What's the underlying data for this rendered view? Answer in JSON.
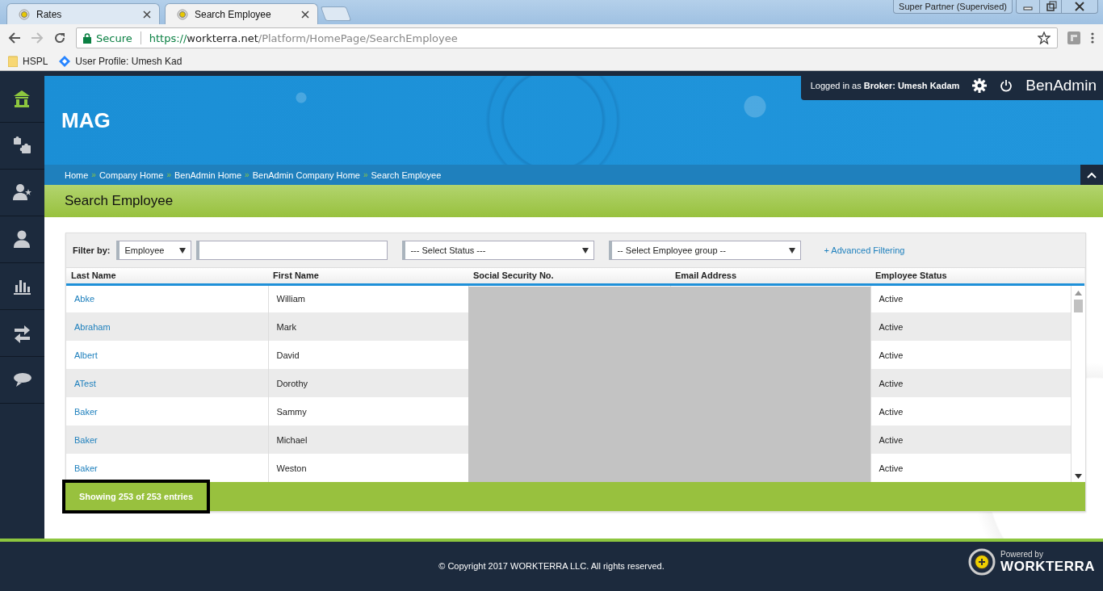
{
  "browser": {
    "tabs": [
      {
        "title": "Rates",
        "selected": false
      },
      {
        "title": "Search Employee",
        "selected": true
      }
    ],
    "profile": "Super Partner (Supervised)",
    "address": {
      "secure_label": "Secure",
      "scheme": "https://",
      "host": "workterra.net",
      "path": "/Platform/HomePage/SearchEmployee"
    },
    "bookmarks": [
      {
        "kind": "folder",
        "label": "HSPL"
      },
      {
        "kind": "site",
        "label": "User Profile: Umesh Kad"
      }
    ]
  },
  "sidebar": {
    "items": [
      {
        "kind": "home",
        "selected": true
      },
      {
        "kind": "puzzle",
        "selected": false
      },
      {
        "kind": "user-star",
        "selected": false
      },
      {
        "kind": "user",
        "selected": false
      },
      {
        "kind": "chart",
        "selected": false
      },
      {
        "kind": "transfer",
        "selected": false
      },
      {
        "kind": "chat",
        "selected": false
      }
    ]
  },
  "header": {
    "company": "MAG",
    "login_prefix": "Logged in as",
    "role": "Broker:",
    "user": "Umesh Kadam",
    "app_name": "BenAdmin"
  },
  "breadcrumb": {
    "separator": "»",
    "items": [
      "Home",
      "Company Home",
      "BenAdmin Home",
      "BenAdmin Company Home",
      "Search Employee"
    ]
  },
  "page_title": "Search Employee",
  "filter": {
    "label": "Filter by:",
    "field": "Employee",
    "status_placeholder": "--- Select Status ---",
    "group_placeholder": "-- Select Employee group --",
    "advanced_link": "+ Advanced Filtering"
  },
  "table": {
    "columns": [
      "Last Name",
      "First Name",
      "Social Security No.",
      "Email Address",
      "Employee Status"
    ],
    "rows": [
      {
        "last_name": "Abke",
        "first_name": "William",
        "status": "Active"
      },
      {
        "last_name": "Abraham",
        "first_name": "Mark",
        "status": "Active"
      },
      {
        "last_name": "Albert",
        "first_name": "David",
        "status": "Active"
      },
      {
        "last_name": "ATest",
        "first_name": "Dorothy",
        "status": "Active"
      },
      {
        "last_name": "Baker",
        "first_name": "Sammy",
        "status": "Active"
      },
      {
        "last_name": "Baker",
        "first_name": "Michael",
        "status": "Active"
      },
      {
        "last_name": "Baker",
        "first_name": "Weston",
        "status": "Active"
      }
    ],
    "summary": "Showing 253 of 253 entries"
  },
  "footer": {
    "copyright": "© Copyright 2017 WORKTERRA LLC. All rights reserved.",
    "powered_by": "Powered by",
    "brand": "WORKTERRA"
  }
}
